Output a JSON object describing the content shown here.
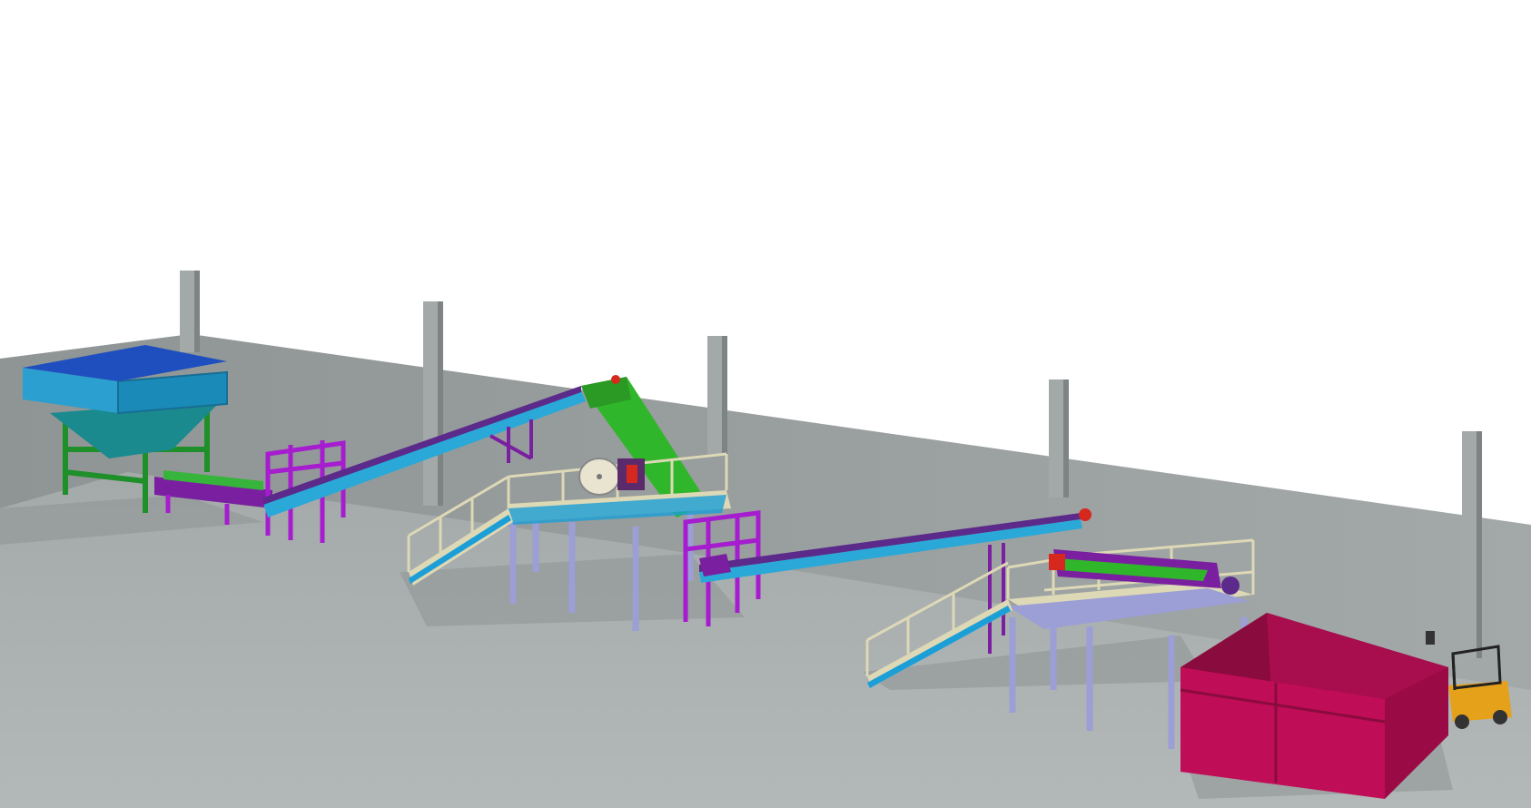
{
  "scene": {
    "colors": {
      "sky": "#ffffff",
      "floor": "#a9aeae",
      "wall": "#9ea3a3",
      "column": "#9aa0a0",
      "hopper": "#1c9fd6",
      "hopper_frame": "#1f8f2a",
      "conveyor_belt": "#2aa9d8",
      "conveyor_frame": "#7a1fa0",
      "support_frame": "#a61ccf",
      "crusher_feed": "#30b62a",
      "platform_railing": "#ddd8b6",
      "platform_legs": "#9c9ed6",
      "container": "#c00d57",
      "forklift": "#e6a11a",
      "motor": "#d6281e"
    },
    "icons": [
      "feed-hopper-icon",
      "belt-conveyor-icon",
      "jaw-crusher-icon",
      "screening-machine-icon",
      "collection-container-icon",
      "forklift-icon"
    ]
  }
}
